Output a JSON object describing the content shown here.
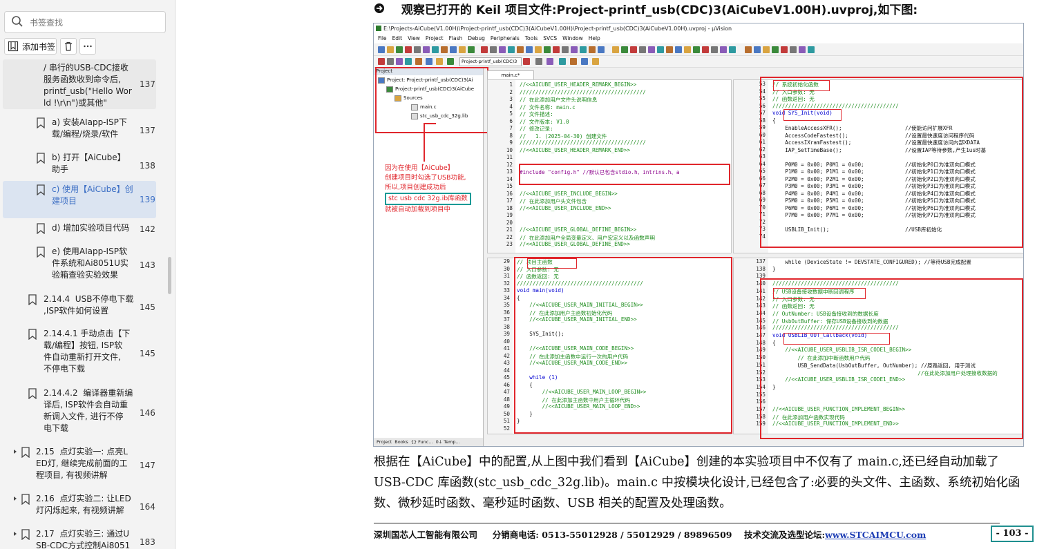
{
  "sidebar": {
    "search_placeholder": "书签查找",
    "add_bookmark_label": "添加书签",
    "items": [
      {
        "text": "/ 串行的USB-CDC接收\n服务函数收到命令后,\nprintf_usb(\"Hello Wor\nld !\\r\\n\")或其他\"",
        "page": "137"
      },
      {
        "text": "a) 安装AIapp-ISP下\n载/编程/烧录/软件",
        "page": "137"
      },
      {
        "text": "b) 打开【AiCube】\n助手",
        "page": "138"
      },
      {
        "text": "c) 使用【AiCube】创\n建项目",
        "page": "139"
      },
      {
        "text": "d) 增加实验项目代码",
        "page": "142"
      },
      {
        "text": "e) 使用AIapp-ISP软\n件系统和Ai8051U实\n验箱查验实验效果",
        "page": "143"
      },
      {
        "text": "2.14.4  USB不停电下载\n,ISP软件如何设置",
        "page": "145"
      },
      {
        "text": "2.14.4.1 手动点击【下\n载/编程】按钮, ISP软\n件自动重新打开文件,\n不停电下载",
        "page": "145"
      },
      {
        "text": "2.14.4.2  编译器重新编\n译后, ISP软件会自动重\n新调入文件, 进行不停\n电下载",
        "page": "146"
      },
      {
        "text": "2.15  点灯实验一: 点亮L\nED灯, 继续完成前面的工\n程项目, 有视频讲解",
        "page": "147"
      },
      {
        "text": "2.16  点灯实验二: 让LED\n灯闪烁起来, 有视频讲解",
        "page": "164"
      },
      {
        "text": "2.17  点灯实验三: 通过U\nSB-CDC方式控制Ai8051",
        "page": "183"
      }
    ]
  },
  "doc": {
    "heading": "观察已打开的 Keil 项目文件:Project-printf_usb(CDC)3(AiCubeV1.00H).uvproj,如下图:",
    "paragraph": "根据在【AiCube】中的配置,从上图中我们看到【AiCube】创建的本实验项目中不仅有了 main.c,还已经自动加载了 USB-CDC 库函数(stc_usb_cdc_32g.lib)。main.c 中按模块化设计,已经包含了:必要的头文件、主函数、系统初始化函数、微秒延时函数、毫秒延时函数、USB 相关的配置及处理函数。",
    "footer_company": "深圳国芯人工智能有限公司",
    "footer_phone": "分销商电话: 0513-55012928 / 55012929 / 89896509",
    "footer_forum": "技术交流及选型论坛:",
    "footer_link": "www.STCAIMCU.com",
    "page_number": "- 103 -"
  },
  "keil": {
    "title": "E:\\Projects-AiCube(V1.00H)\\Project-printf_usb(CDC)3(AiCubeV1.00H)\\Project-printf_usb(CDC)3(AiCubeV1.00H).uvproj - µVision",
    "menus": [
      "File",
      "Edit",
      "View",
      "Project",
      "Flash",
      "Debug",
      "Peripherals",
      "Tools",
      "SVCS",
      "Window",
      "Help"
    ],
    "target": "Project-printf_usb(CDC)3",
    "project_header": "Project",
    "tree": [
      "Project: Project-printf_usb(CDC)3(Ai",
      "Project-printf_usb(CDC)3(AiCube",
      "Sources",
      "main.c",
      "stc_usb_cdc_32g.lib"
    ],
    "panel_tabs": [
      "Project",
      "Books",
      "{} Func...",
      "0↓ Temp..."
    ],
    "editor_tab": "main.c*",
    "annotation_lines": [
      "因为在使用【AiCube】",
      "创建项目时勾选了USB功能,",
      "所以,项目创建成功后"
    ],
    "annotation_teal": "stc usb cdc 32g.ib库函数",
    "annotation_last": "就被自动加载到项目中",
    "pane_tl": {
      "lines": [
        "1",
        "2",
        "3",
        "4",
        "5",
        "6",
        "7",
        "8",
        "9",
        "10",
        "11",
        "12",
        "13",
        "14",
        "15",
        "16",
        "17",
        "18",
        "19",
        "20",
        "21",
        "22",
        "23"
      ],
      "code": [
        [
          "cm",
          "//<<AICUBE_USER_HEADER_REMARK_BEGIN>>"
        ],
        [
          "cm",
          "////////////////////////////////////////"
        ],
        [
          "cm",
          "// 在此添加用户文件头说明信息"
        ],
        [
          "cm",
          "// 文件名称: main.c"
        ],
        [
          "cm",
          "// 文件描述:"
        ],
        [
          "cm",
          "// 文件版本: V1.0"
        ],
        [
          "cm",
          "// 修改记录:"
        ],
        [
          "cm",
          "//   1. (2025-04-30) 创建文件"
        ],
        [
          "cm",
          "////////////////////////////////////////"
        ],
        [
          "cm",
          "//<<AICUBE_USER_HEADER_REMARK_END>>"
        ],
        [
          "tx",
          ""
        ],
        [
          "tx",
          ""
        ],
        [
          "pp",
          "#include \"config.h\" //默认已包含stdio.h、intrins.h、a"
        ],
        [
          "tx",
          ""
        ],
        [
          "tx",
          ""
        ],
        [
          "cm",
          "//<<AICUBE_USER_INCLUDE_BEGIN>>"
        ],
        [
          "cm",
          "// 在此添加用户头文件包含"
        ],
        [
          "cm",
          "//<<AICUBE_USER_INCLUDE_END>>"
        ],
        [
          "tx",
          ""
        ],
        [
          "tx",
          ""
        ],
        [
          "cm",
          "//<<AICUBE_USER_GLOBAL_DEFINE_BEGIN>>"
        ],
        [
          "cm",
          "// 在此添加用户全局变量定义、用户宏定义以及函数声明"
        ],
        [
          "cm",
          "//<<AICUBE_USER_GLOBAL_DEFINE_END>>"
        ]
      ]
    },
    "pane_bl": {
      "lines": [
        "29",
        "30",
        "31",
        "32",
        "33",
        "34",
        "35",
        "36",
        "37",
        "38",
        "39",
        "40",
        "41",
        "42",
        "43",
        "44",
        "45",
        "46",
        "47",
        "48",
        "49",
        "50",
        "51",
        "52"
      ],
      "code": [
        [
          "cm",
          "// 项目主函数"
        ],
        [
          "cm",
          "// 入口参数: 无"
        ],
        [
          "cm",
          "// 函数返回: 无"
        ],
        [
          "cm",
          "////////////////////////////////////////"
        ],
        [
          "kw",
          "void main(void)"
        ],
        [
          "tx",
          "{"
        ],
        [
          "cm",
          "    //<<AICUBE_USER_MAIN_INITIAL_BEGIN>>"
        ],
        [
          "cm",
          "    // 在此添加用户主函数初始化代码"
        ],
        [
          "cm",
          "    //<<AICUBE_USER_MAIN_INITIAL_END>>"
        ],
        [
          "tx",
          ""
        ],
        [
          "tx",
          "    SYS_Init();"
        ],
        [
          "tx",
          ""
        ],
        [
          "cm",
          "    //<<AICUBE_USER_MAIN_CODE_BEGIN>>"
        ],
        [
          "cm",
          "    // 在此添加主函数中运行一次的用户代码"
        ],
        [
          "cm",
          "    //<<AICUBE_USER_MAIN_CODE_END>>"
        ],
        [
          "tx",
          ""
        ],
        [
          "kw",
          "    while (1)"
        ],
        [
          "tx",
          "    {"
        ],
        [
          "cm",
          "        //<<AICUBE_USER_MAIN_LOOP_BEGIN>>"
        ],
        [
          "cm",
          "        // 在此添加主函数中用户主循环代码"
        ],
        [
          "cm",
          "        //<<AICUBE_USER_MAIN_LOOP_END>>"
        ],
        [
          "tx",
          "    }"
        ],
        [
          "tx",
          "}"
        ],
        [
          "tx",
          ""
        ]
      ]
    },
    "pane_tr": {
      "lines": [
        "53",
        "54",
        "55",
        "56",
        "57",
        "58",
        "59",
        "60",
        "61",
        "62",
        "63",
        "64",
        "65",
        "66",
        "67",
        "68",
        "69",
        "70",
        "71",
        "72",
        "73",
        "74"
      ],
      "code": [
        [
          "cm",
          "// 系统初始化函数"
        ],
        [
          "cm",
          "// 入口参数: 无"
        ],
        [
          "cm",
          "// 函数返回: 无"
        ],
        [
          "cm",
          "////////////////////////////////////////"
        ],
        [
          "kw",
          "void SYS_Init(void)"
        ],
        [
          "tx",
          "{"
        ],
        [
          "tx",
          "    EnableAccessXFR();                    //使能访问扩展XFR"
        ],
        [
          "tx",
          "    AccessCodeFastest();                  //设置最快速度访问程序代码"
        ],
        [
          "tx",
          "    AccessIXramFastest();                 //设置最快速度访问内部XDATA"
        ],
        [
          "tx",
          "    IAP_SetTimeBase();                    //设置IAP等待参数,产生1us时基"
        ],
        [
          "tx",
          ""
        ],
        [
          "tx",
          "    P0M0 = 0x00; P0M1 = 0x00;             //初始化P0口为准双向口模式"
        ],
        [
          "tx",
          "    P1M0 = 0x00; P1M1 = 0x00;             //初始化P1口为准双向口模式"
        ],
        [
          "tx",
          "    P2M0 = 0x00; P2M1 = 0x00;             //初始化P2口为准双向口模式"
        ],
        [
          "tx",
          "    P3M0 = 0x00; P3M1 = 0x00;             //初始化P3口为准双向口模式"
        ],
        [
          "tx",
          "    P4M0 = 0x00; P4M1 = 0x00;             //初始化P4口为准双向口模式"
        ],
        [
          "tx",
          "    P5M0 = 0x00; P5M1 = 0x00;             //初始化P5口为准双向口模式"
        ],
        [
          "tx",
          "    P6M0 = 0x00; P6M1 = 0x00;             //初始化P6口为准双向口模式"
        ],
        [
          "tx",
          "    P7M0 = 0x00; P7M1 = 0x00;             //初始化P7口为准双向口模式"
        ],
        [
          "tx",
          ""
        ],
        [
          "tx",
          "    USBLIB_Init();                        //USB库初始化"
        ],
        [
          "tx",
          ""
        ]
      ]
    },
    "pane_br": {
      "lines": [
        "137",
        "138",
        "139",
        "140",
        "141",
        "142",
        "143",
        "144",
        "145",
        "146",
        "147",
        "148",
        "149",
        "150",
        "151",
        "152",
        "153",
        "154",
        "155",
        "156",
        "157",
        "158",
        "159"
      ],
      "code": [
        [
          "tx",
          "    while (DeviceState != DEVSTATE_CONFIGURED); //等待USB完成配置"
        ],
        [
          "tx",
          "}"
        ],
        [
          "tx",
          ""
        ],
        [
          "cm",
          "////////////////////////////////////////"
        ],
        [
          "cm",
          "// USB设备接收数据中断回调程序"
        ],
        [
          "cm",
          "// 入口参数: 无"
        ],
        [
          "cm",
          "// 函数返回: 无"
        ],
        [
          "cm",
          "// OutNumber: USB设备接收到的数据长度"
        ],
        [
          "cm",
          "// UsbOutBuffer: 保存USB设备接收到的数据"
        ],
        [
          "cm",
          "////////////////////////////////////////"
        ],
        [
          "kw",
          "void USBLIB_OUT_Callback(void)"
        ],
        [
          "tx",
          "{"
        ],
        [
          "cm",
          "    //<<AICUBE_USER_USBLIB_ISR_CODE1_BEGIN>>"
        ],
        [
          "cm",
          "        // 在此添加中断函数用户代码"
        ],
        [
          "tx",
          "        USB_SendData(UsbOutBuffer, OutNumber); //原路返回, 用于测试"
        ],
        [
          "cm",
          "                                              //在此处添加用户处理接收数据的"
        ],
        [
          "cm",
          "    //<<AICUBE_USER_USBLIB_ISR_CODE1_END>>"
        ],
        [
          "tx",
          "}"
        ],
        [
          "tx",
          ""
        ],
        [
          "tx",
          ""
        ],
        [
          "cm",
          "//<<AICUBE_USER_FUNCTION_IMPLEMENT_BEGIN>>"
        ],
        [
          "cm",
          "// 在此添加用户函数实现代码"
        ],
        [
          "cm",
          "//<<AICUBE_USER_FUNCTION_IMPLEMENT_END>>"
        ]
      ]
    }
  }
}
